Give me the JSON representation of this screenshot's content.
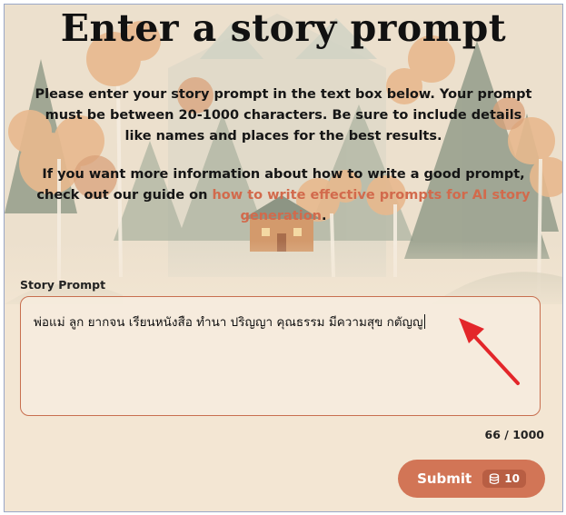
{
  "heading": "Enter a story prompt",
  "instructions": "Please enter your story prompt in the text box below. Your prompt must be between 20-1000 characters. Be sure to include details like names and places for the best results.",
  "guide": {
    "before": "If you want more information about how to write a good prompt, check out our guide on ",
    "link_text": "how to write effective prompts for AI story generation",
    "after": "."
  },
  "prompt_field": {
    "label": "Story Prompt",
    "value": "พ่อแม่ ลูก ยากจน เรียนหนังสือ ทำนา ปริญญา คุณธรรม มีความสุข กตัญญู"
  },
  "counter": "66 / 1000",
  "submit": {
    "label": "Submit",
    "credits": "10",
    "credits_icon": "database-coins-icon"
  },
  "annotation": {
    "icon": "red-arrow-icon",
    "color": "#e3262a"
  },
  "colors": {
    "background": "#f3e6d3",
    "accent": "#d27556",
    "link": "#d26a4c",
    "field_border": "#c86f4f"
  }
}
